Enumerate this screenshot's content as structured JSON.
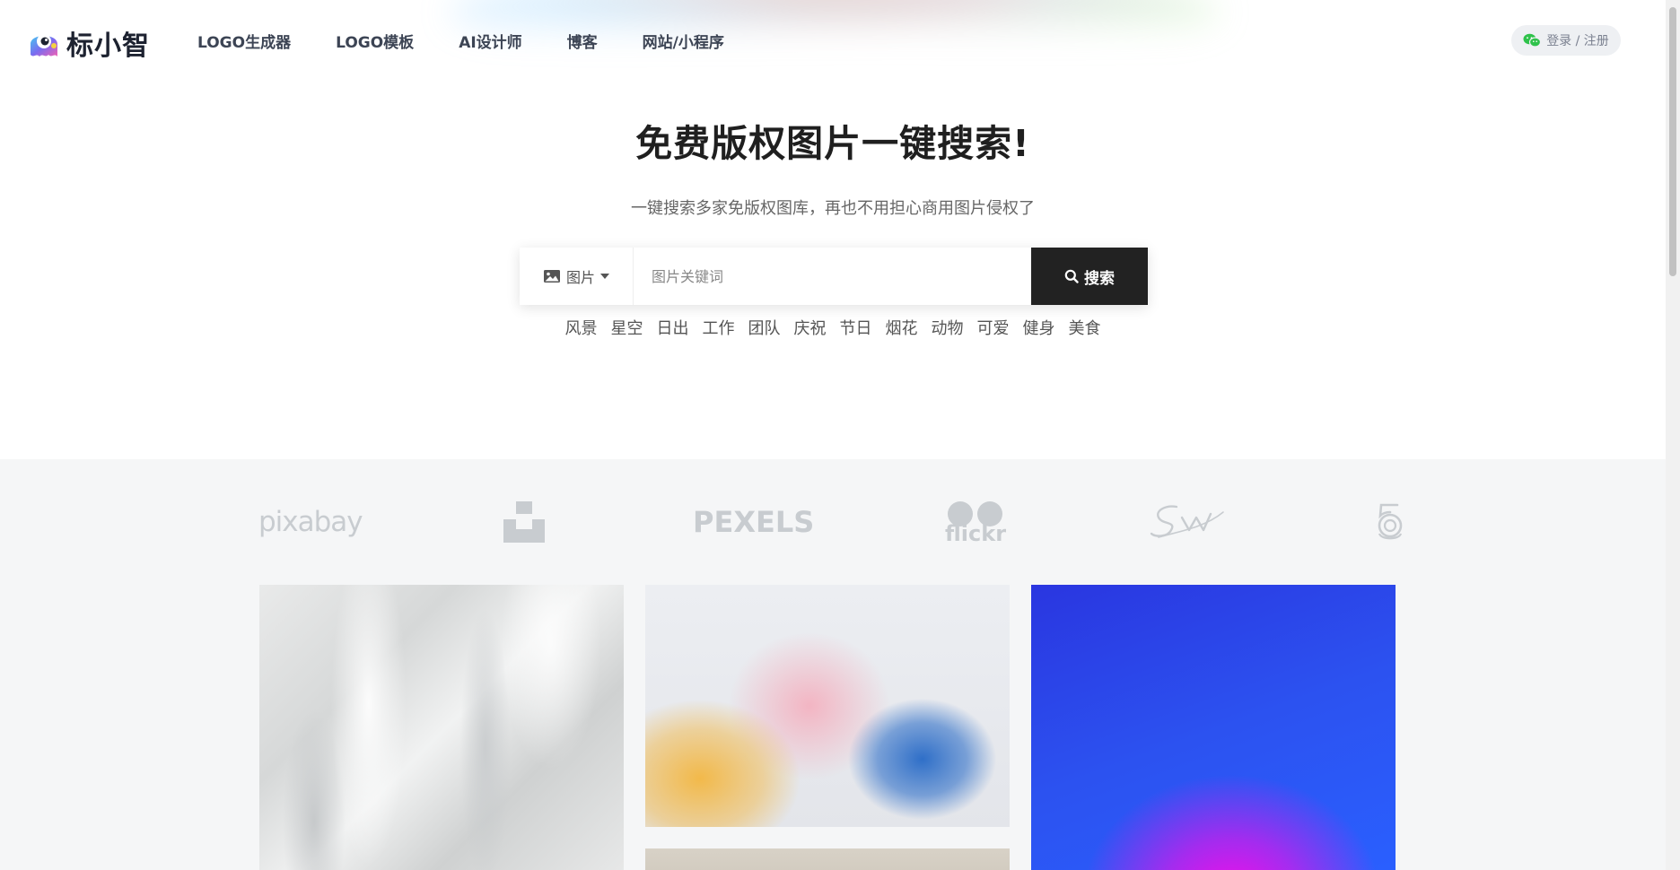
{
  "brand": {
    "name": "标小智"
  },
  "nav": {
    "items": [
      {
        "label": "LOGO生成器"
      },
      {
        "label": "LOGO模板"
      },
      {
        "label": "AI设计师"
      },
      {
        "label": "博客"
      },
      {
        "label": "网站/小程序"
      }
    ]
  },
  "login": {
    "label": "登录 / 注册",
    "icon": "wechat-icon"
  },
  "hero": {
    "title": "免费版权图片一键搜索!",
    "subtitle": "一键搜索多家免版权图库，再也不用担心商用图片侵权了"
  },
  "search": {
    "type_label": "图片",
    "placeholder": "图片关键词",
    "button_label": "搜索"
  },
  "tags": [
    "风景",
    "星空",
    "日出",
    "工作",
    "团队",
    "庆祝",
    "节日",
    "烟花",
    "动物",
    "可爱",
    "健身",
    "美食"
  ],
  "sources": {
    "pixabay": "pixabay",
    "pexels": "PEXELS",
    "flickr": "flickr",
    "unsplash_icon": "unsplash-logo-icon",
    "stocksnap_icon": "stocksnap-logo-icon",
    "fivehundred_icon": "500px-logo-icon"
  },
  "colors": {
    "search_button": "#222222",
    "gallery_background": "#f5f6f7",
    "source_logo": "#c8ccd0",
    "wechat": "#2fc24b"
  }
}
